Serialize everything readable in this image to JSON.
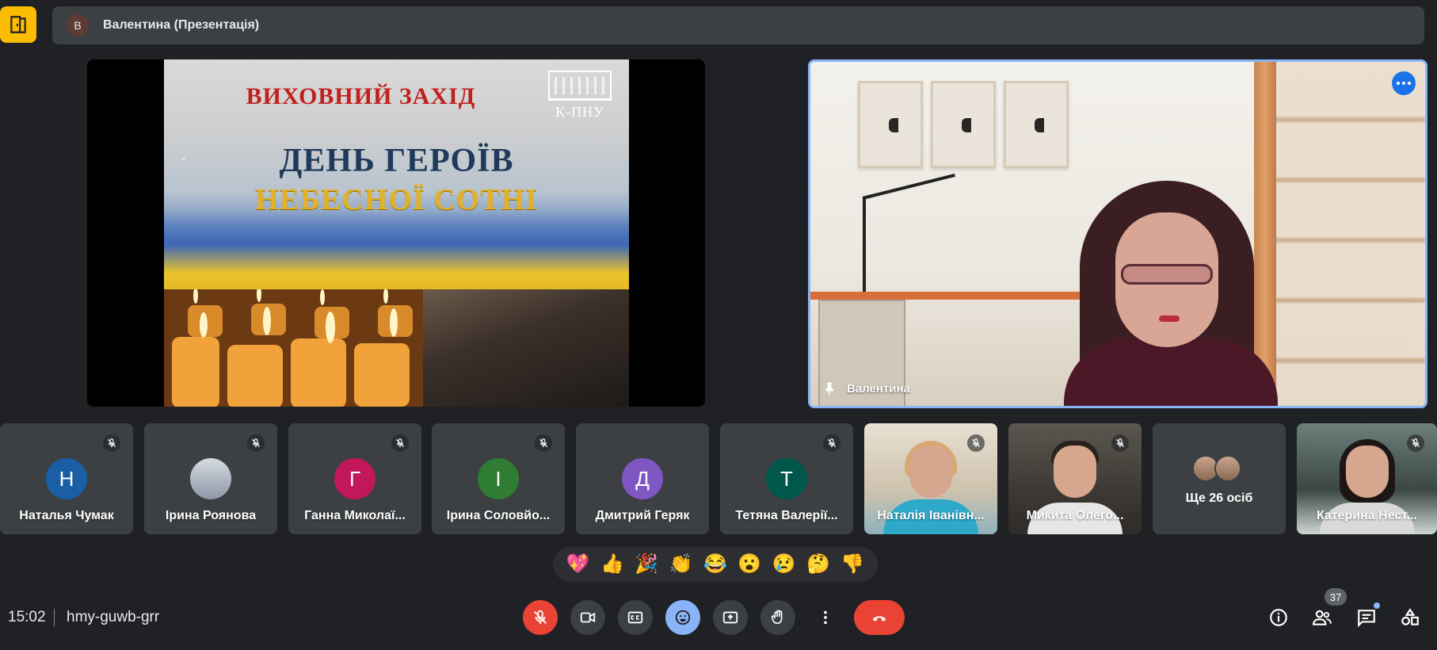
{
  "top_bar": {
    "presenter_initial": "В",
    "presenter_title": "Валентина (Презентація)"
  },
  "slide": {
    "heading": "ВИХОВНИЙ ЗАХІД",
    "title_line1": "ДЕНЬ ГЕРОЇВ",
    "title_line2": "НЕБЕСНОЇ СОТНІ",
    "logo_text": "К-ПНУ"
  },
  "speaker": {
    "name": "Валентина"
  },
  "participants": [
    {
      "name": "Наталья Чумак",
      "initial": "Н",
      "color": "#1a5fa6"
    },
    {
      "name": "Ірина Роянова",
      "initial": "",
      "color": "#9fa7b3"
    },
    {
      "name": "Ганна Миколаї...",
      "initial": "Г",
      "color": "#c2185b"
    },
    {
      "name": "Ірина Соловйо...",
      "initial": "І",
      "color": "#2e7d32"
    },
    {
      "name": "Дмитрий Геряк",
      "initial": "Д",
      "color": "#7e57c2"
    },
    {
      "name": "Тетяна Валерії...",
      "initial": "Т",
      "color": "#00574b"
    },
    {
      "name": "Наталія Іванівн..."
    },
    {
      "name": "Микита Олего..."
    },
    {
      "name": "Ще 26 осіб"
    },
    {
      "name": "Катерина Нест..."
    }
  ],
  "reactions": [
    "💖",
    "👍",
    "🎉",
    "👏",
    "😂",
    "😮",
    "😢",
    "🤔",
    "👎"
  ],
  "bottom_bar": {
    "time": "15:02",
    "meeting_code": "hmy-guwb-grr",
    "people_count": "37"
  },
  "colors": {
    "background": "#202124",
    "tile": "#3c4043",
    "accent_blue": "#8ab4f8",
    "danger_red": "#ea4335",
    "logo_yellow": "#fbbc04"
  }
}
